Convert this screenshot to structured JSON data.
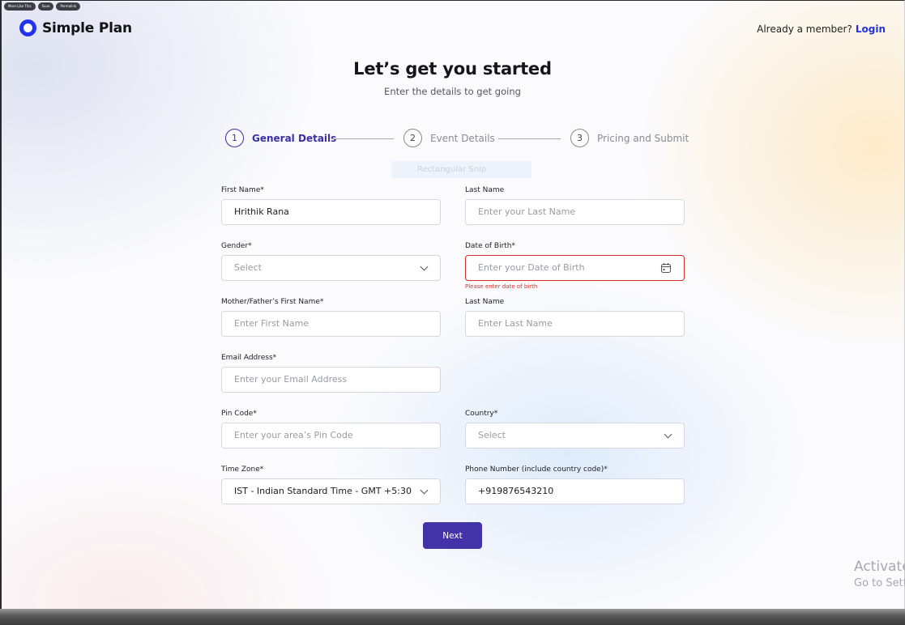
{
  "toolbar_pills": [
    "More Like This",
    "Save",
    "Permalink"
  ],
  "brand": {
    "name": "Simple Plan"
  },
  "header": {
    "member_text": "Already a member?",
    "login_label": "Login"
  },
  "title": "Let’s get you started",
  "subtitle": "Enter the details to get going",
  "stepper": {
    "steps": [
      {
        "number": "1",
        "label": "General Details",
        "active": true
      },
      {
        "number": "2",
        "label": "Event Details",
        "active": false
      },
      {
        "number": "3",
        "label": "Pricing and Submit",
        "active": false
      }
    ]
  },
  "snip_overlay": "Rectangular Snip",
  "form": {
    "first_name": {
      "label": "First Name*",
      "value": "Hrithik Rana",
      "placeholder": ""
    },
    "last_name": {
      "label": "Last Name",
      "value": "",
      "placeholder": "Enter your Last Name"
    },
    "gender": {
      "label": "Gender*",
      "value": "",
      "placeholder": "Select"
    },
    "dob": {
      "label": "Date of Birth*",
      "value": "",
      "placeholder": "Enter your Date of Birth",
      "error": "Please enter date of birth"
    },
    "parent_first_name": {
      "label": "Mother/Father’s First Name*",
      "value": "",
      "placeholder": "Enter First Name"
    },
    "parent_last_name": {
      "label": "Last Name",
      "value": "",
      "placeholder": "Enter Last Name"
    },
    "email": {
      "label": "Email Address*",
      "value": "",
      "placeholder": "Enter your Email Address"
    },
    "pin_code": {
      "label": "Pin Code*",
      "value": "",
      "placeholder": "Enter your area’s Pin Code"
    },
    "country": {
      "label": "Country*",
      "value": "",
      "placeholder": "Select"
    },
    "time_zone": {
      "label": "Time Zone*",
      "value": "IST - Indian Standard Time - GMT +5:30",
      "placeholder": ""
    },
    "phone": {
      "label": "Phone Number (include country code)*",
      "value": "+919876543210",
      "placeholder": ""
    }
  },
  "next_label": "Next",
  "watermark": {
    "line1": "Activate",
    "line2": "Go to Settings"
  },
  "colors": {
    "accent": "#4433a8",
    "brand": "#2233ee",
    "error": "#d82c2c"
  }
}
